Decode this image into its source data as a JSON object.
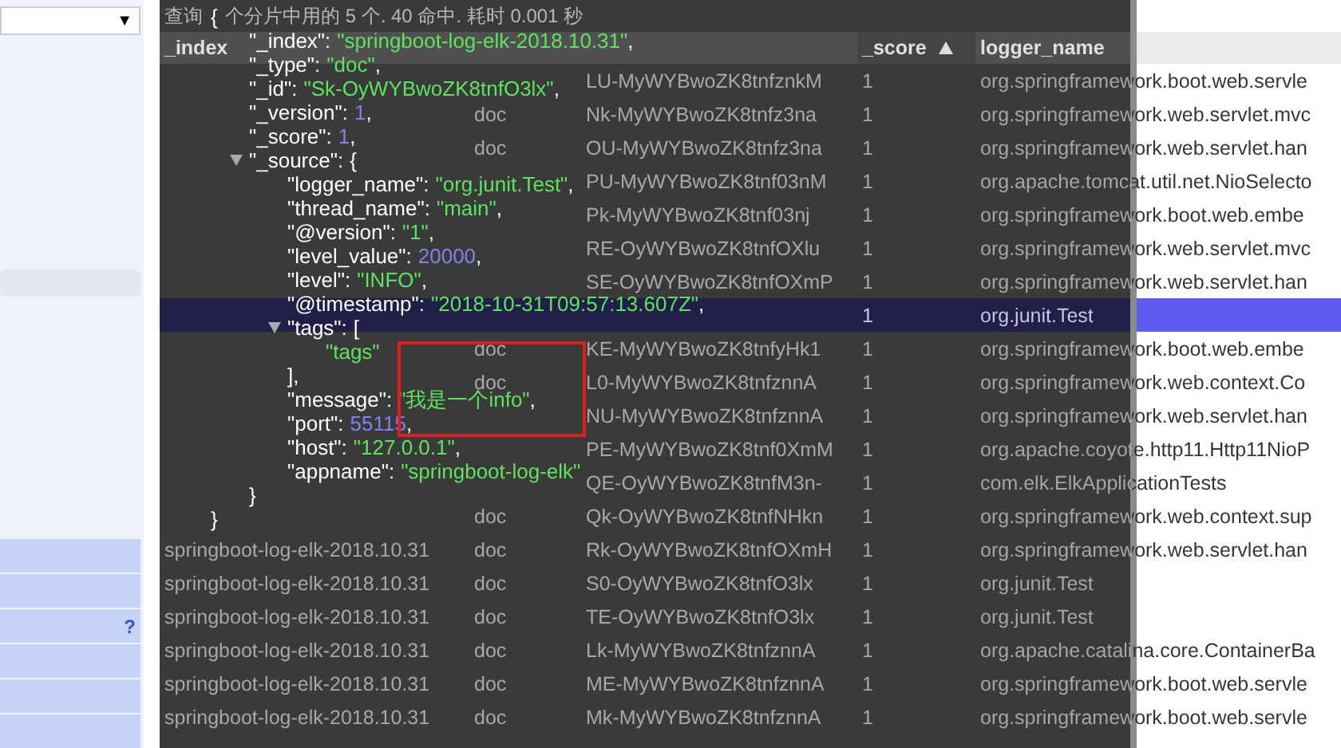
{
  "sidebar": {
    "dropdown": {
      "caret": "▼"
    },
    "help_link": "?"
  },
  "results": {
    "summary": [
      "查询",
      "个分片中用的 5 个. 40 命中. 耗时 0.001 秒"
    ],
    "columns": [
      {
        "label": "_index",
        "sorted": false
      },
      {
        "sorted": false
      },
      {
        "sorted": false
      },
      {
        "label": "_score",
        "sorted": true
      },
      {
        "label": "logger_name",
        "sorted": false
      }
    ],
    "rows": [
      {
        "id": "LU-MyWYBwoZK8tnfznkM",
        "score": "1",
        "logger_name": "org.springframework.boot.web.servle",
        "selected": false
      },
      {
        "type": "doc",
        "id": "Nk-MyWYBwoZK8tnfz3na",
        "score": "1",
        "logger_name": "org.springframework.web.servlet.mvc",
        "selected": false
      },
      {
        "type": "doc",
        "id": "OU-MyWYBwoZK8tnfz3na",
        "score": "1",
        "logger_name": "org.springframework.web.servlet.han",
        "selected": false
      },
      {
        "id": "PU-MyWYBwoZK8tnf03nM",
        "score": "1",
        "logger_name": "org.apache.tomcat.util.net.NioSelecto",
        "selected": false
      },
      {
        "id": "Pk-MyWYBwoZK8tnf03nj",
        "score": "1",
        "logger_name": "org.springframework.boot.web.embe",
        "selected": false
      },
      {
        "id": "RE-OyWYBwoZK8tnfOXlu",
        "score": "1",
        "logger_name": "org.springframework.web.servlet.mvc",
        "selected": false
      },
      {
        "id": "SE-OyWYBwoZK8tnfOXmP",
        "score": "1",
        "logger_name": "org.springframework.web.servlet.han",
        "selected": false
      },
      {
        "score": "1",
        "logger_name": "org.junit.Test",
        "selected": true
      },
      {
        "type": "doc",
        "id": "KE-MyWYBwoZK8tnfyHk1",
        "score": "1",
        "logger_name": "org.springframework.boot.web.embe",
        "selected": false
      },
      {
        "type": "doc",
        "id": "L0-MyWYBwoZK8tnfznnA",
        "score": "1",
        "logger_name": "org.springframework.web.context.Co",
        "selected": false
      },
      {
        "id": "NU-MyWYBwoZK8tnfznnA",
        "score": "1",
        "logger_name": "org.springframework.web.servlet.han",
        "selected": false
      },
      {
        "id": "PE-MyWYBwoZK8tnf0XmM",
        "score": "1",
        "logger_name": "org.apache.coyote.http11.Http11NioP",
        "selected": false
      },
      {
        "id": "QE-OyWYBwoZK8tnfM3n-",
        "score": "1",
        "logger_name": "com.elk.ElkApplicationTests",
        "selected": false
      },
      {
        "type": "doc",
        "id": "Qk-OyWYBwoZK8tnfNHkn",
        "score": "1",
        "logger_name": "org.springframework.web.context.sup",
        "selected": false
      },
      {
        "index": "springboot-log-elk-2018.10.31",
        "type": "doc",
        "id": "Rk-OyWYBwoZK8tnfOXmH",
        "score": "1",
        "logger_name": "org.springframework.web.servlet.han",
        "selected": false
      },
      {
        "index": "springboot-log-elk-2018.10.31",
        "type": "doc",
        "id": "S0-OyWYBwoZK8tnfO3lx",
        "score": "1",
        "logger_name": "org.junit.Test",
        "selected": false
      },
      {
        "index": "springboot-log-elk-2018.10.31",
        "type": "doc",
        "id": "TE-OyWYBwoZK8tnfO3lx",
        "score": "1",
        "logger_name": "org.junit.Test",
        "selected": false
      },
      {
        "index": "springboot-log-elk-2018.10.31",
        "type": "doc",
        "id": "Lk-MyWYBwoZK8tnfznnA",
        "score": "1",
        "logger_name": "org.apache.catalina.core.ContainerBa",
        "selected": false
      },
      {
        "index": "springboot-log-elk-2018.10.31",
        "type": "doc",
        "id": "ME-MyWYBwoZK8tnfznnA",
        "score": "1",
        "logger_name": "org.springframework.boot.web.servle",
        "selected": false
      },
      {
        "index": "springboot-log-elk-2018.10.31",
        "type": "doc",
        "id": "Mk-MyWYBwoZK8tnfznnA",
        "score": "1",
        "logger_name": "org.springframework.boot.web.servle",
        "selected": false
      }
    ]
  },
  "json_viewer": {
    "open": "{",
    "close": "}",
    "entries": [
      {
        "key": "\"_index\":",
        "value": "\"springboot-log-elk-2018.10.31\"",
        "color": "#5ee35e",
        "tail": ","
      },
      {
        "key": "\"_type\":",
        "value": "\"doc\"",
        "color": "#5ee35e",
        "tail": ","
      },
      {
        "key": "\"_id\":",
        "value": "\"Sk-OyWYBwoZK8tnfO3lx\"",
        "color": "#5ee35e",
        "tail": ","
      },
      {
        "key": "\"_version\":",
        "value": "1",
        "color": "#8080f0",
        "tail": ","
      },
      {
        "key": "\"_score\":",
        "value": "1",
        "color": "#8080f0",
        "tail": ","
      },
      {
        "key": "\"_source\":",
        "open": "{",
        "close": "}",
        "expanded": true,
        "children": [
          {
            "key": "\"logger_name\":",
            "value": "\"org.junit.Test\"",
            "color": "#5ee35e",
            "tail": ","
          },
          {
            "key": "\"thread_name\":",
            "value": "\"main\"",
            "color": "#5ee35e",
            "tail": ","
          },
          {
            "key": "\"@version\":",
            "value": "\"1\"",
            "color": "#5ee35e",
            "tail": ","
          },
          {
            "key": "\"level_value\":",
            "value": "20000",
            "color": "#8080f0",
            "tail": ","
          },
          {
            "key": "\"level\":",
            "value": "\"INFO\"",
            "color": "#5ee35e",
            "tail": ","
          },
          {
            "key": "\"@timestamp\":",
            "value": "\"2018-10-31T09:57:13.607Z\"",
            "color": "#5ee35e",
            "tail": ","
          },
          {
            "key": "\"tags\":",
            "open": "[",
            "close": "],",
            "expanded": true,
            "children": [
              {
                "value": "\"tags\"",
                "color": "#5ee35e"
              }
            ]
          },
          {
            "key": "\"message\":",
            "value": "\"我是一个info\"",
            "color": "#5ee35e",
            "tail": ","
          },
          {
            "key": "\"port\":",
            "value": "55115",
            "color": "#8080f0",
            "tail": ","
          },
          {
            "key": "\"host\":",
            "value": "\"127.0.0.1\"",
            "color": "#5ee35e",
            "tail": ","
          },
          {
            "key": "\"appname\":",
            "value": "\"springboot-log-elk\"",
            "color": "#5ee35e"
          }
        ]
      }
    ]
  },
  "annotation": {
    "kind": "rectangle"
  }
}
